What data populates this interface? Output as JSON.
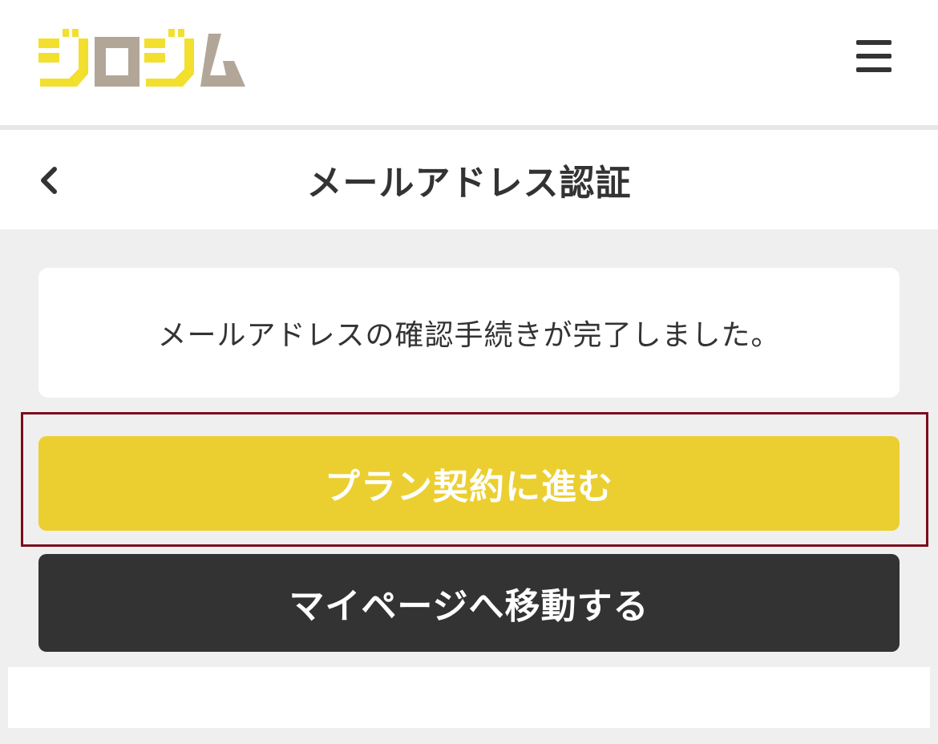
{
  "header": {
    "logo_text": "ジロジム",
    "logo_colors": [
      "#f3df2e",
      "#b2a698",
      "#f3df2e",
      "#b2a698"
    ],
    "menu_icon": "hamburger-icon"
  },
  "titlebar": {
    "back_icon": "chevron-left-icon",
    "title": "メールアドレス認証"
  },
  "message": {
    "text": "メールアドレスの確認手続きが完了しました。"
  },
  "actions": {
    "plan_label": "プラン契約に進む",
    "mypage_label": "マイページへ移動する"
  },
  "colors": {
    "accent_yellow": "#ebcf31",
    "dark_button": "#333333",
    "page_bg": "#efefef",
    "highlight_border": "#7a0c1c"
  }
}
